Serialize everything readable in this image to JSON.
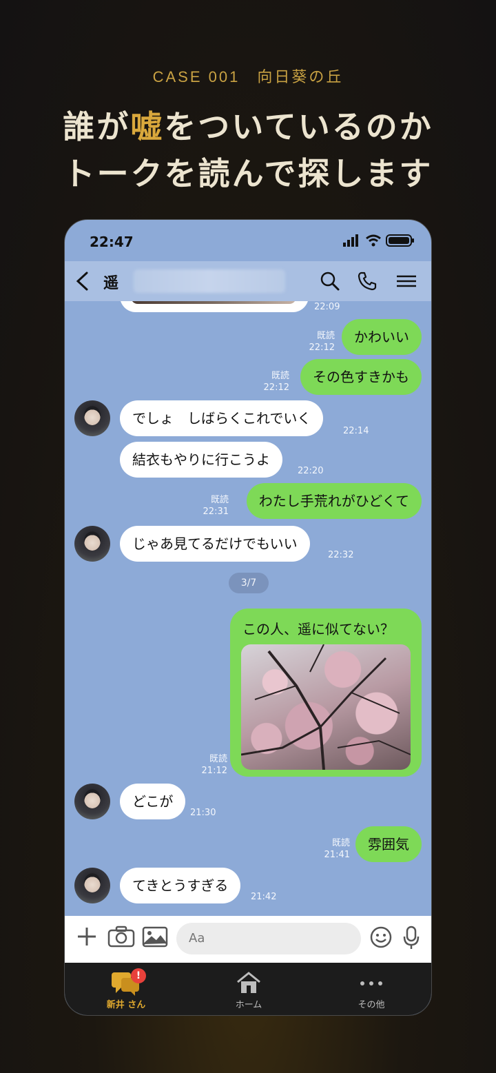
{
  "promo": {
    "case_label": "CASE 001　向日葵の丘",
    "headline_line1_pre": "誰が",
    "headline_line1_highlight": "嘘",
    "headline_line1_post": "をついているのか",
    "headline_line2": "トークを読んで探します"
  },
  "status_bar": {
    "time": "22:47"
  },
  "chat_header": {
    "name": "遥"
  },
  "messages": [
    {
      "id": "m0",
      "side": "in",
      "text": "",
      "time": "22:09"
    },
    {
      "id": "m1",
      "side": "out",
      "text": "かわいい",
      "read": "既読",
      "time": "22:12"
    },
    {
      "id": "m2",
      "side": "out",
      "text": "その色すきかも",
      "read": "既読",
      "time": "22:12"
    },
    {
      "id": "m3",
      "side": "in",
      "text": "でしょ　しばらくこれでいく",
      "time": "22:14"
    },
    {
      "id": "m4",
      "side": "in",
      "text": "結衣もやりに行こうよ",
      "time": "22:20"
    },
    {
      "id": "m5",
      "side": "out",
      "text": "わたし手荒れがひどくて",
      "read": "既読",
      "time": "22:31"
    },
    {
      "id": "m6",
      "side": "in",
      "text": "じゃあ見てるだけでもいい",
      "time": "22:32"
    },
    {
      "id": "m7",
      "side": "out",
      "text": "この人、遥に似てない？",
      "read": "既読",
      "time": "21:12",
      "has_photo": true
    },
    {
      "id": "m8",
      "side": "in",
      "text": "どこが",
      "time": "21:30"
    },
    {
      "id": "m9",
      "side": "out",
      "text": "雰囲気",
      "read": "既読",
      "time": "21:41"
    },
    {
      "id": "m10",
      "side": "in",
      "text": "てきとうすぎる",
      "time": "21:42"
    }
  ],
  "page_indicator": "3/7",
  "input": {
    "placeholder": "Aa"
  },
  "tabs": [
    {
      "label": "新井 さん",
      "active": true,
      "badge": "!"
    },
    {
      "label": "ホーム",
      "active": false
    },
    {
      "label": "その他",
      "active": false
    }
  ],
  "colors": {
    "chat_bg": "#8daad7",
    "out_bubble": "#7ed957",
    "in_bubble": "#ffffff",
    "accent_gold": "#d9a83c",
    "badge_red": "#e8413b"
  }
}
